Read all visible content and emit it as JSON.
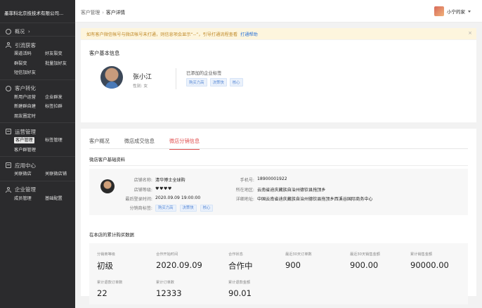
{
  "sidebar": {
    "company": "墨菲科北京技技术有限公司...",
    "overview": "概况",
    "sections": [
      {
        "title": "引流获客",
        "items": [
          "渠道活码",
          "好友裂变",
          "群裂变",
          "批量加好友",
          "短信加好友"
        ]
      },
      {
        "title": "客户转化",
        "items": [
          "新用户运营",
          "企业群发",
          "新建群自建",
          "标签拉群",
          "朋友圈定时"
        ]
      },
      {
        "title": "运营管理",
        "items": [
          "客户管理",
          "标签管理",
          "客户群管理"
        ]
      },
      {
        "title": "应用中心",
        "items": [
          "关联微店",
          "关联微店铺"
        ]
      },
      {
        "title": "企业管理",
        "items": [
          "成员管理",
          "基础配置"
        ]
      }
    ]
  },
  "header": {
    "breadcrumb": [
      "客户管理",
      "客户详情"
    ],
    "user_name": "小宁的家"
  },
  "notice": {
    "text": "如有客户微信帐号与微店帐号未打通，则信息项会显示“--”，引导打通流程查看",
    "link": "打通帮助"
  },
  "basic_info": {
    "title": "客户基本信息",
    "name": "张小江",
    "gender": "性别: 女",
    "tags_title": "已添加的企业标签",
    "tags": [
      "购买力高",
      "决策快",
      "核心"
    ]
  },
  "tabs": [
    "客户概况",
    "微店成交信息",
    "微店分销信息"
  ],
  "active_tab": 2,
  "store_section": {
    "title": "微店客户基础资料",
    "fields": [
      {
        "k": "店铺名称:",
        "v": "清华博士全球购"
      },
      {
        "k": "店铺等级:",
        "v": "♥♥♥♥"
      },
      {
        "k": "最后登录时间:",
        "v": "2020.09.09 19:00:00"
      },
      {
        "k": "分销商标签:",
        "tags": [
          "购买力高",
          "决策快",
          "核心"
        ]
      },
      {
        "k": "手机号:",
        "v": "18900001922"
      },
      {
        "k": "所在地区:",
        "v": "云南省迪庆藏族自治州德钦县拖顶乡"
      },
      {
        "k": "详细地址:",
        "v": "中国云南省迪庆藏族自治州德钦县拖顶乡西溪谷国际商务中心"
      }
    ]
  },
  "stats_section": {
    "title": "在本店的累计购买数据",
    "stats": [
      {
        "label": "分销商等级",
        "value": "初级"
      },
      {
        "label": "合作开始时间",
        "value": "2020.09.09"
      },
      {
        "label": "合作状态",
        "value": "合作中"
      },
      {
        "label": "最近30天订单数",
        "value": "900"
      },
      {
        "label": "最近30天销售金额",
        "value": "900.00"
      },
      {
        "label": "累计销售金额",
        "value": "90000.00"
      },
      {
        "label": "累计退款订单数",
        "value": "22"
      },
      {
        "label": "累计订单数",
        "value": "12333"
      },
      {
        "label": "累计退款金额",
        "value": "90.01"
      }
    ]
  }
}
